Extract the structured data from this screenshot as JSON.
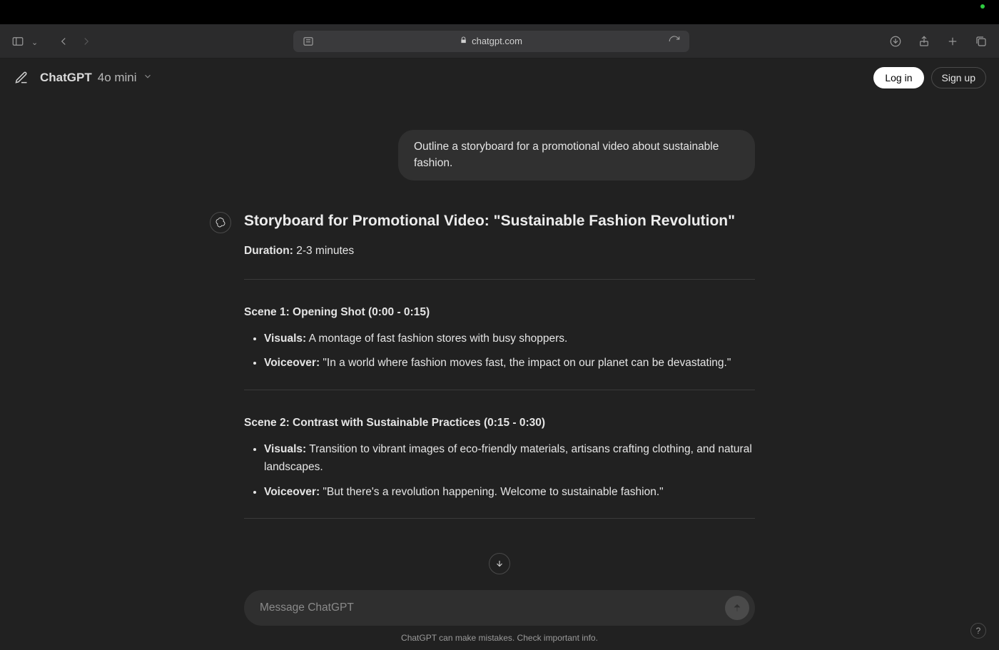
{
  "browser": {
    "url": "chatgpt.com"
  },
  "header": {
    "brand": "ChatGPT",
    "model_suffix": "4o mini",
    "login_label": "Log in",
    "signup_label": "Sign up"
  },
  "conversation": {
    "user_prompt": "Outline a storyboard for a promotional video about sustainable fashion.",
    "response": {
      "title": "Storyboard for Promotional Video: \"Sustainable Fashion Revolution\"",
      "duration_label": "Duration:",
      "duration_value": " 2-3 minutes",
      "scenes": [
        {
          "heading": "Scene 1: Opening Shot (0:00 - 0:15)",
          "items": [
            {
              "label": "Visuals:",
              "text": " A montage of fast fashion stores with busy shoppers."
            },
            {
              "label": "Voiceover:",
              "text": " \"In a world where fashion moves fast, the impact on our planet can be devastating.\""
            }
          ]
        },
        {
          "heading": "Scene 2: Contrast with Sustainable Practices (0:15 - 0:30)",
          "items": [
            {
              "label": "Visuals:",
              "text": " Transition to vibrant images of eco-friendly materials, artisans crafting clothing, and natural landscapes."
            },
            {
              "label": "Voiceover:",
              "text": " \"But there's a revolution happening. Welcome to sustainable fashion.\""
            }
          ]
        }
      ]
    }
  },
  "composer": {
    "placeholder": "Message ChatGPT"
  },
  "footer": {
    "disclaimer": "ChatGPT can make mistakes. Check important info.",
    "help": "?"
  }
}
